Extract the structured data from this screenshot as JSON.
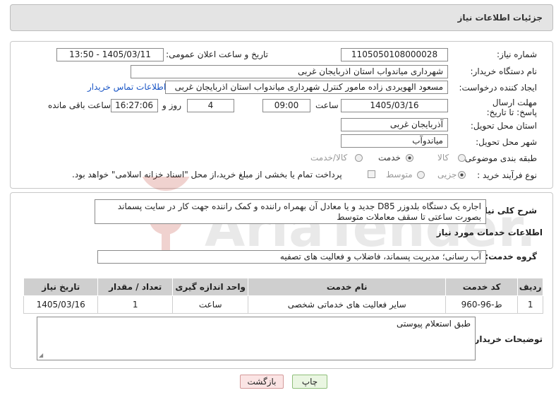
{
  "header": {
    "title": "جزئیات اطلاعات نیاز"
  },
  "form": {
    "need_number": {
      "label": "شماره نیاز:",
      "value": "1105050108000028"
    },
    "announce_datetime": {
      "label": "تاریخ و ساعت اعلان عمومی:",
      "value": "1405/03/11 - 13:50"
    },
    "buyer_org": {
      "label": "نام دستگاه خریدار:",
      "value": "شهرداری میاندواب استان اذربایجان غربی"
    },
    "requester": {
      "label": "ایجاد کننده درخواست:",
      "value": "مسعود الهویردی زاده مامور کنترل شهرداری میاندواب استان اذربایجان غربی",
      "contact_link": "اطلاعات تماس خریدار"
    },
    "deadline": {
      "label": "مهلت ارسال پاسخ: تا تاریخ:",
      "date": "1405/03/16",
      "time_label": "ساعت",
      "time": "09:00",
      "days": "4",
      "days_label": "روز و",
      "remaining": "16:27:06",
      "remaining_label": "ساعت باقی مانده"
    },
    "delivery_province": {
      "label": "استان محل تحویل:",
      "value": "آذربایجان غربی"
    },
    "delivery_city": {
      "label": "شهر محل تحویل:",
      "value": "میاندوآب"
    },
    "category": {
      "label": "طبقه بندی موضوعی:",
      "options": [
        "کالا",
        "خدمت",
        "کالا/خدمت"
      ],
      "selected": "خدمت"
    },
    "purchase_type": {
      "label": "نوع فرآیند خرید :",
      "options": [
        "جزیی",
        "متوسط"
      ],
      "selected": "جزیی",
      "note": "پرداخت تمام یا بخشی از مبلغ خرید،از محل \"اسناد خزانه اسلامی\" خواهد بود."
    }
  },
  "description": {
    "label": "شرح کلی نیاز:",
    "value": "اجاره یک دستگاه بلدوزر D85 جدید و یا معادل آن بهمراه راننده و کمک راننده جهت کار در سایت پسماند بصورت ساعتی تا سقف معاملات متوسط"
  },
  "services": {
    "section_title": "اطلاعات خدمات مورد نیاز",
    "group_label": "گروه خدمت:",
    "group_value": "آب رسانی؛ مدیریت پسماند، فاضلاب و فعالیت های تصفیه",
    "table": {
      "headers": [
        "ردیف",
        "کد خدمت",
        "نام خدمت",
        "واحد اندازه گیری",
        "تعداد / مقدار",
        "تاریخ نیاز"
      ],
      "rows": [
        [
          "1",
          "ط-96-960",
          "سایر فعالیت های خدماتی شخصی",
          "ساعت",
          "1",
          "1405/03/16"
        ]
      ]
    }
  },
  "buyer_notes": {
    "label": "توضیحات خریدار:",
    "value": "طبق استعلام پیوستی"
  },
  "buttons": {
    "print": "چاپ",
    "back": "بازگشت"
  },
  "watermark_text": "AriaTender.neT"
}
